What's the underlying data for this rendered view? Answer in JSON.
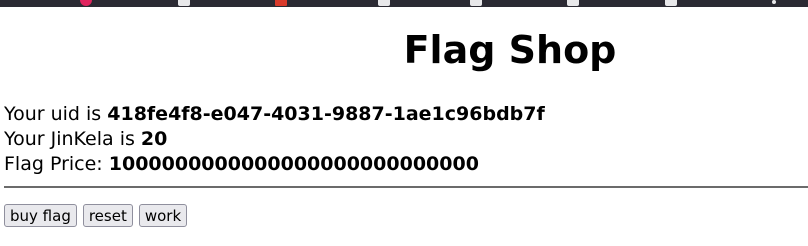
{
  "page": {
    "title": "Flag Shop"
  },
  "info": {
    "uid_label": "Your uid is",
    "uid_value": "418fe4f8-e047-4031-9887-1ae1c96bdb7f",
    "jinkela_label": "Your JinKela is",
    "jinkela_value": "20",
    "price_label": "Flag Price:",
    "price_value": "1000000000000000000000000000"
  },
  "actions": {
    "buy_label": "buy flag",
    "reset_label": "reset",
    "work_label": "work"
  },
  "colors": {
    "browser_bar": "#2b2a33",
    "button_bg": "#e9e9ed",
    "button_border": "#8f8f9d",
    "divider": "#6b6b6b"
  },
  "icons": [
    "favicon-red-icon",
    "tab-icon",
    "tab-icon-red",
    "tab-icon",
    "tab-icon",
    "tab-icon",
    "tab-icon",
    "more-dot-icon"
  ]
}
